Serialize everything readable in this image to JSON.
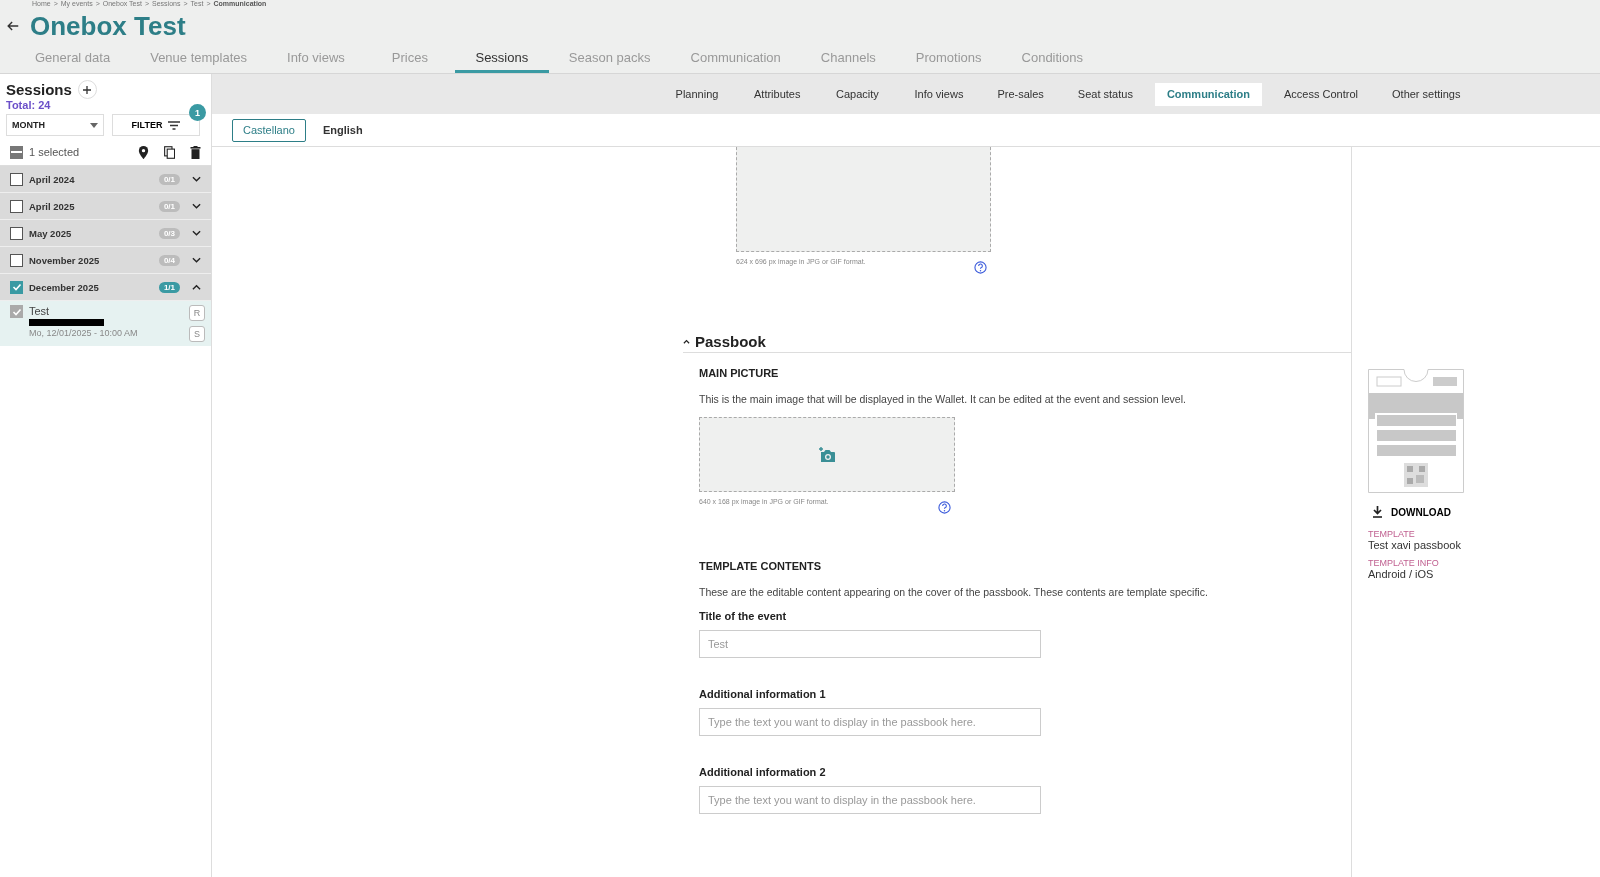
{
  "breadcrumb": [
    {
      "label": "Home",
      "current": false
    },
    {
      "label": "My events",
      "current": false
    },
    {
      "label": "Onebox Test",
      "current": false
    },
    {
      "label": "Sessions",
      "current": false
    },
    {
      "label": "Test",
      "current": false
    },
    {
      "label": "Communication",
      "current": true
    }
  ],
  "breadcrumb_separator": ">",
  "title": "Onebox Test",
  "tabs": [
    {
      "label": "General data",
      "selected": false
    },
    {
      "label": "Venue templates",
      "selected": false
    },
    {
      "label": "Info views",
      "selected": false
    },
    {
      "label": "Prices",
      "selected": false
    },
    {
      "label": "Sessions",
      "selected": true
    },
    {
      "label": "Season packs",
      "selected": false
    },
    {
      "label": "Communication",
      "selected": false
    },
    {
      "label": "Channels",
      "selected": false
    },
    {
      "label": "Promotions",
      "selected": false
    },
    {
      "label": "Conditions",
      "selected": false
    }
  ],
  "sidebar": {
    "title": "Sessions",
    "total": "Total: 24",
    "period_select": "MONTH",
    "filter_button": "FILTER",
    "filter_count": "1",
    "selection": "1 selected",
    "select_all_partial": true,
    "groups": [
      {
        "label": "April 2024",
        "count": "0/1",
        "checked": false,
        "expanded": false
      },
      {
        "label": "April 2025",
        "count": "0/1",
        "checked": false,
        "expanded": false
      },
      {
        "label": "May 2025",
        "count": "0/3",
        "checked": false,
        "expanded": false
      },
      {
        "label": "November 2025",
        "count": "0/4",
        "checked": false,
        "expanded": false
      },
      {
        "label": "December 2025",
        "count": "1/1",
        "checked": true,
        "expanded": true,
        "sessions": [
          {
            "name": "Test",
            "date": "Mo, 12/01/2025 - 10:00 AM",
            "checked": true,
            "tags": [
              "R",
              "S"
            ]
          }
        ]
      }
    ]
  },
  "subtabs": [
    {
      "label": "Planning",
      "selected": false
    },
    {
      "label": "Attributes",
      "selected": false
    },
    {
      "label": "Capacity",
      "selected": false
    },
    {
      "label": "Info views",
      "selected": false
    },
    {
      "label": "Pre-sales",
      "selected": false
    },
    {
      "label": "Seat status",
      "selected": false
    },
    {
      "label": "Communication",
      "selected": true
    },
    {
      "label": "Access Control",
      "selected": false
    },
    {
      "label": "Other settings",
      "selected": false
    }
  ],
  "languages": [
    {
      "label": "Castellano",
      "selected": true
    },
    {
      "label": "English",
      "selected": false
    }
  ],
  "upper_image": {
    "hint": "624 x 696 px image in JPG or GIF format."
  },
  "passbook": {
    "title": "Passbook",
    "expanded": true,
    "main_picture": {
      "heading": "MAIN PICTURE",
      "description": "This is the main image that will be displayed in the Wallet. It can be edited at the event and session level.",
      "hint": "640 x 168 px image in JPG or GIF format."
    },
    "template_contents": {
      "heading": "TEMPLATE CONTENTS",
      "description": "These are the editable content appearing on the cover of the passbook. These contents are template specific.",
      "fields": [
        {
          "label": "Title of the event",
          "placeholder": "Test"
        },
        {
          "label": "Additional information 1",
          "placeholder": "Type the text you want to display in the passbook here."
        },
        {
          "label": "Additional information 2",
          "placeholder": "Type the text you want to display in the passbook here."
        }
      ]
    }
  },
  "template_panel": {
    "download": "DOWNLOAD",
    "template_label": "TEMPLATE",
    "template_value": "Test xavi passbook",
    "info_label": "TEMPLATE INFO",
    "info_value": "Android / iOS"
  }
}
